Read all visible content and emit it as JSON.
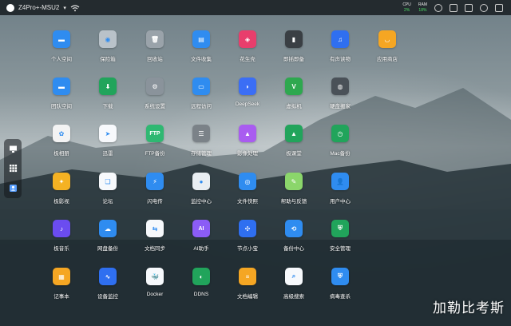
{
  "topbar": {
    "device_name": "Z4Pro+-MSU2",
    "cpu_label": "CPU",
    "cpu_value": "2%",
    "ram_label": "RAM",
    "ram_value": "18%"
  },
  "dock": {
    "items": [
      "monitor-icon",
      "grid-icon",
      "user-card-icon"
    ]
  },
  "apps": [
    {
      "label": "个人空间",
      "icon": "folder-icon",
      "color": "#2f8cf0",
      "glyph": "▬"
    },
    {
      "label": "保险箱",
      "icon": "safe-icon",
      "color": "#b9c2c9",
      "glyph": "◉"
    },
    {
      "label": "回收站",
      "icon": "trash-icon",
      "color": "#9aa3aa",
      "glyph": "🗑"
    },
    {
      "label": "文件收集",
      "icon": "file-collect-icon",
      "color": "#2f8cf0",
      "glyph": "▤"
    },
    {
      "label": "花生壳",
      "icon": "peanut-shell-icon",
      "color": "#e83e6c",
      "glyph": "◈"
    },
    {
      "label": "即插即备",
      "icon": "plug-backup-icon",
      "color": "#3a3f44",
      "glyph": "▮"
    },
    {
      "label": "有声读物",
      "icon": "audiobook-icon",
      "color": "#2f6ff0",
      "glyph": "♫"
    },
    {
      "label": "应用商店",
      "icon": "app-store-icon",
      "color": "#f5a623",
      "glyph": "◡"
    },
    {
      "label": "团队空间",
      "icon": "team-folder-icon",
      "color": "#2f8cf0",
      "glyph": "▬"
    },
    {
      "label": "下载",
      "icon": "download-icon",
      "color": "#21a45b",
      "glyph": "⬇"
    },
    {
      "label": "系统设置",
      "icon": "settings-icon",
      "color": "#8a939b",
      "glyph": "⚙"
    },
    {
      "label": "远程访问",
      "icon": "remote-access-icon",
      "color": "#2f8cf0",
      "glyph": "▭"
    },
    {
      "label": "DeepSeek",
      "icon": "deepseek-icon",
      "color": "#3b6ef5",
      "glyph": "◗"
    },
    {
      "label": "虚拟机",
      "icon": "vm-icon",
      "color": "#2ea84f",
      "glyph": "V"
    },
    {
      "label": "硬盘搬家",
      "icon": "disk-move-icon",
      "color": "#4a5158",
      "glyph": "◍"
    },
    {
      "label": "极相册",
      "icon": "photos-icon",
      "color": "#f3f3f3",
      "glyph": "✿"
    },
    {
      "label": "迅雷",
      "icon": "thunder-icon",
      "color": "#f7f9fc",
      "glyph": "➤"
    },
    {
      "label": "FTP备份",
      "icon": "ftp-icon",
      "color": "#2fb872",
      "glyph": "FTP"
    },
    {
      "label": "存储管理",
      "icon": "storage-icon",
      "color": "#7b8288",
      "glyph": "☰"
    },
    {
      "label": "影像处理",
      "icon": "image-process-icon",
      "color": "#a95cf0",
      "glyph": "▲"
    },
    {
      "label": "极课堂",
      "icon": "classroom-icon",
      "color": "#21a45b",
      "glyph": "▲"
    },
    {
      "label": "Mac备份",
      "icon": "mac-backup-icon",
      "color": "#21a45b",
      "glyph": "◷"
    },
    {
      "label": "极影视",
      "icon": "video-icon",
      "color": "#f5b223",
      "glyph": "✦"
    },
    {
      "label": "论坛",
      "icon": "forum-icon",
      "color": "#f7f9fc",
      "glyph": "❏"
    },
    {
      "label": "闪电传",
      "icon": "flash-transfer-icon",
      "color": "#2f8cf0",
      "glyph": "⚡"
    },
    {
      "label": "监控中心",
      "icon": "monitor-center-icon",
      "color": "#e9eef2",
      "glyph": "●"
    },
    {
      "label": "文件快照",
      "icon": "snapshot-icon",
      "color": "#2f8cf0",
      "glyph": "◎"
    },
    {
      "label": "帮助与反馈",
      "icon": "help-icon",
      "color": "#8bd66b",
      "glyph": "✎"
    },
    {
      "label": "用户中心",
      "icon": "user-center-icon",
      "color": "#2f8cf0",
      "glyph": "👤"
    },
    {
      "label": "极音乐",
      "icon": "music-icon",
      "color": "#6b4cf0",
      "glyph": "♪"
    },
    {
      "label": "网盘备份",
      "icon": "cloud-backup-icon",
      "color": "#2f8cf0",
      "glyph": "☁"
    },
    {
      "label": "文档同步",
      "icon": "doc-sync-icon",
      "color": "#f7f9fc",
      "glyph": "⇆"
    },
    {
      "label": "AI助手",
      "icon": "ai-assistant-icon",
      "color": "#8b5cf6",
      "glyph": "AI"
    },
    {
      "label": "节点小宝",
      "icon": "node-icon",
      "color": "#2f6ff0",
      "glyph": "✣"
    },
    {
      "label": "备份中心",
      "icon": "backup-center-icon",
      "color": "#2f8cf0",
      "glyph": "⟲"
    },
    {
      "label": "安全管理",
      "icon": "security-icon",
      "color": "#21a45b",
      "glyph": "⛨"
    },
    {
      "label": "记事本",
      "icon": "notepad-icon",
      "color": "#f5a623",
      "glyph": "▦"
    },
    {
      "label": "设备监控",
      "icon": "device-monitor-icon",
      "color": "#2f6ff0",
      "glyph": "∿"
    },
    {
      "label": "Docker",
      "icon": "docker-icon",
      "color": "#f7f9fc",
      "glyph": "🐳"
    },
    {
      "label": "DDNS",
      "icon": "ddns-icon",
      "color": "#21a45b",
      "glyph": "◐"
    },
    {
      "label": "文档编辑",
      "icon": "doc-edit-icon",
      "color": "#f5a623",
      "glyph": "≡"
    },
    {
      "label": "高级搜索",
      "icon": "advanced-search-icon",
      "color": "#f7f9fc",
      "glyph": "⌕"
    },
    {
      "label": "病毒查杀",
      "icon": "antivirus-icon",
      "color": "#2f8cf0",
      "glyph": "⛨"
    }
  ],
  "watermark": "加勒比考斯"
}
